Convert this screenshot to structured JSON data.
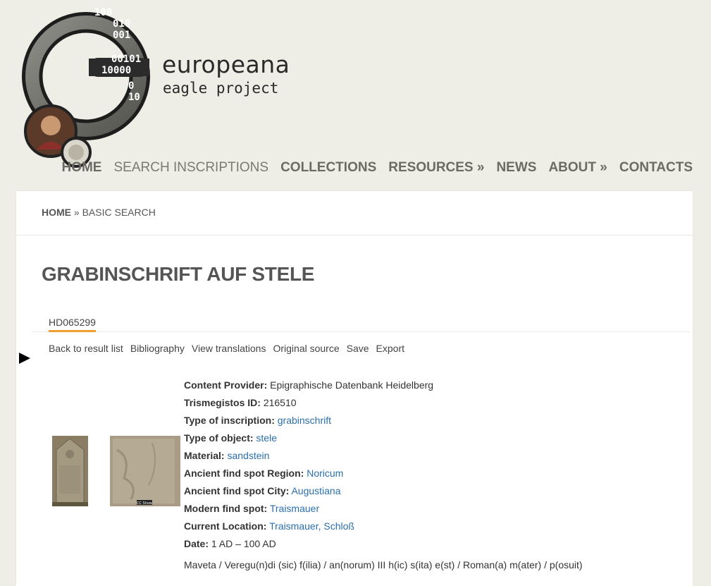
{
  "brand": {
    "name": "europeana",
    "subtitle": "eagle project",
    "logo_binary_text": [
      "100",
      "010",
      "001",
      "00101",
      "10000",
      "0",
      "10"
    ]
  },
  "nav": {
    "items": [
      {
        "label": "HOME",
        "active": false
      },
      {
        "label": "SEARCH INSCRIPTIONS",
        "active": true
      },
      {
        "label": "COLLECTIONS",
        "active": false
      },
      {
        "label": "RESOURCES »",
        "active": false
      },
      {
        "label": "NEWS",
        "active": false
      },
      {
        "label": "ABOUT »",
        "active": false
      },
      {
        "label": "CONTACTS",
        "active": false
      }
    ]
  },
  "breadcrumb": {
    "home": "HOME",
    "separator": " » ",
    "current": "BASIC SEARCH"
  },
  "page": {
    "title": "GRABINSCHRIFT AUF STELE"
  },
  "tabs": {
    "record_id": "HD065299"
  },
  "actions": [
    "Back to result list",
    "Bibliography",
    "View translations",
    "Original source",
    "Save",
    "Export"
  ],
  "images": {
    "thumb_2_caption": "CC Show"
  },
  "fields": [
    {
      "label": "Content Provider:",
      "value": "Epigraphische Datenbank Heidelberg",
      "link": false
    },
    {
      "label": "Trismegistos ID:",
      "value": "216510",
      "link": false
    },
    {
      "label": "Type of inscription:",
      "value": "grabinschrift",
      "link": true
    },
    {
      "label": "Type of object:",
      "value": "stele",
      "link": true
    },
    {
      "label": "Material:",
      "value": "sandstein",
      "link": true
    },
    {
      "label": "Ancient find spot Region:",
      "value": "Noricum",
      "link": true
    },
    {
      "label": "Ancient find spot City:",
      "value": "Augustiana",
      "link": true
    },
    {
      "label": "Modern find spot:",
      "value": "Traismauer",
      "link": true
    },
    {
      "label": "Current Location:",
      "value": "Traismauer, Schloß",
      "link": true
    },
    {
      "label": "Date:",
      "value": "1 AD – 100 AD",
      "link": false
    }
  ],
  "transcription": "Maveta / Veregu(n)di (sic) f(ilia) / an(norum) III h(ic) s(ita) e(st) / Roman(a) m(ater) / p(osuit)",
  "colors": {
    "accent": "#f0a030",
    "link": "#2a6fad",
    "background": "#efeee6"
  }
}
